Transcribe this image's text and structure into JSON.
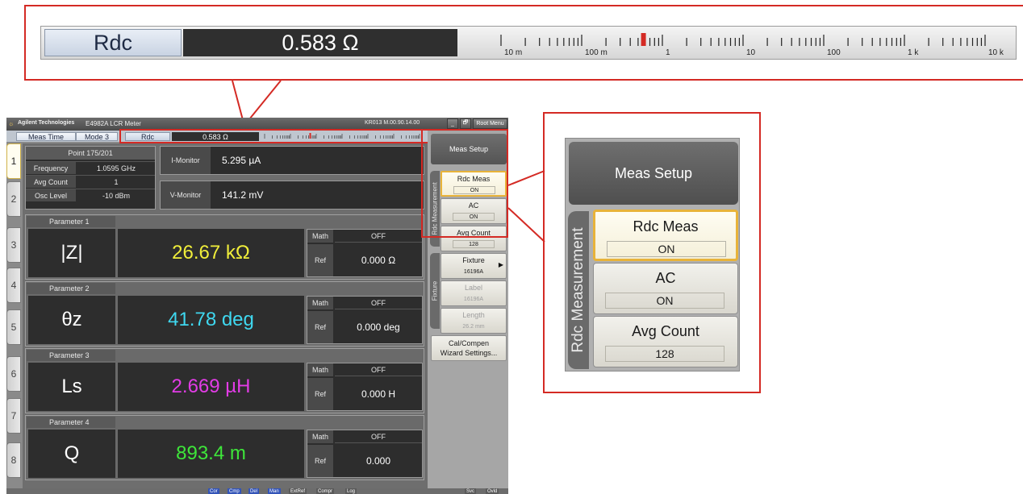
{
  "zoom_bar": {
    "label": "Rdc",
    "value": "0.583 Ω",
    "scale_labels": [
      "10 m",
      "100 m",
      "1",
      "10",
      "100",
      "1 k",
      "10 k"
    ]
  },
  "titlebar": {
    "logo_glyph": "☼",
    "brand": "Agilent Technologies",
    "title": "E4982A LCR Meter",
    "firmware": "KR013 M.00.90.14.00",
    "minimize": "_",
    "restore": "🗗",
    "root_menu": "Root Menu"
  },
  "statusline": {
    "meas_time": "Meas Time",
    "mode": "Mode 3",
    "rdc_label": "Rdc",
    "rdc_value": "0.583 Ω"
  },
  "channel_tabs": [
    "1",
    "2",
    "3",
    "4",
    "5",
    "6",
    "7",
    "8"
  ],
  "point_box": {
    "title": "Point 175/201",
    "rows": [
      {
        "key": "Frequency",
        "value": "1.0595 GHz"
      },
      {
        "key": "Avg Count",
        "value": "1"
      },
      {
        "key": "Osc Level",
        "value": "-10 dBm"
      }
    ]
  },
  "monitors": [
    {
      "key": "I-Monitor",
      "value": "5.295 µA"
    },
    {
      "key": "V-Monitor",
      "value": "141.2 mV"
    }
  ],
  "parameters": [
    {
      "head": "Parameter 1",
      "name": "|Z|",
      "value": "26.67 kΩ",
      "color": "#f0ee3a",
      "math_label": "Math",
      "math_value": "OFF",
      "ref_label": "Ref",
      "ref_value": "0.000 Ω"
    },
    {
      "head": "Parameter 2",
      "name": "θz",
      "value": "41.78 deg",
      "color": "#3fd8f0",
      "math_label": "Math",
      "math_value": "OFF",
      "ref_label": "Ref",
      "ref_value": "0.000 deg"
    },
    {
      "head": "Parameter 3",
      "name": "Ls",
      "value": "2.669 µH",
      "color": "#e23ce6",
      "math_label": "Math",
      "math_value": "OFF",
      "ref_label": "Ref",
      "ref_value": "0.000 H"
    },
    {
      "head": "Parameter 4",
      "name": "Q",
      "value": "893.4 m",
      "color": "#3ee63a",
      "math_label": "Math",
      "math_value": "OFF",
      "ref_label": "Ref",
      "ref_value": "0.000"
    }
  ],
  "menu": {
    "head": "Meas Setup",
    "group_rdc": "Rdc Measurement",
    "group_fixture": "Fixture",
    "rdc_meas_label": "Rdc Meas",
    "rdc_meas_value": "ON",
    "ac_label": "AC",
    "ac_value": "ON",
    "avg_label": "Avg Count",
    "avg_value": "128",
    "fixture_label": "Fixture",
    "fixture_value": "16196A",
    "label_label": "Label",
    "label_value": "16196A",
    "length_label": "Length",
    "length_value": "26.2 mm",
    "cal_label_1": "Cal/Compen",
    "cal_label_2": "Wizard Settings..."
  },
  "bottombar": {
    "buttons": [
      "Cor",
      "Cmp",
      "Del",
      "Man",
      "ExtRef",
      "Compr",
      "Log"
    ],
    "right_buttons": [
      "Svc",
      "Ovld"
    ]
  },
  "colors": {
    "highlight_red": "#d42a24",
    "selected_gold": "#e8b33a"
  }
}
